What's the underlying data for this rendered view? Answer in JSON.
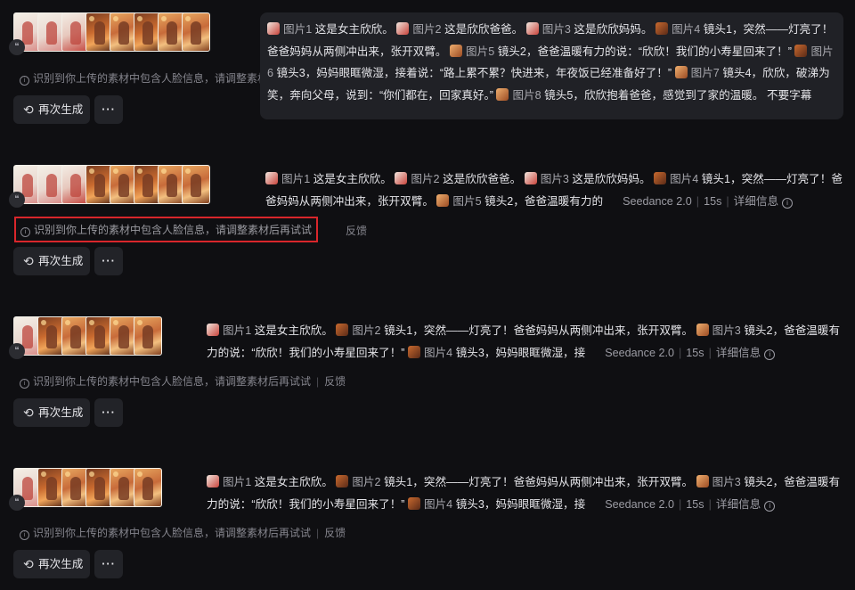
{
  "cards": [
    {
      "prompt_segments": [
        {
          "ref": "图片1",
          "text": "这是女主欣欣。"
        },
        {
          "ref": "图片2",
          "text": "这是欣欣爸爸。"
        },
        {
          "ref": "图片3",
          "text": "这是欣欣妈妈。"
        },
        {
          "ref": "图片4",
          "text": "镜头1，突然——灯亮了！爸爸妈妈从两侧冲出来，张开双臂。"
        },
        {
          "ref": "图片5",
          "text": "镜头2，爸爸温暖有力的说：“欣欣！我们的小寿星回来了！”"
        },
        {
          "ref": "图片6",
          "text": "镜头3，妈妈眼眶微湿，接着说：“路上累不累？快进来，年夜饭已经准备好了！”"
        },
        {
          "ref": "图片7",
          "text": "镜头4，欣欣，破涕为笑，奔向父母，说到：“你们都在，回家真好。”"
        },
        {
          "ref": "图片8",
          "text": "镜头5，欣欣抱着爸爸，感觉到了家的温暖。 不要字幕"
        }
      ],
      "warning": "识别到你上传的素材中包含人脸信息，请调整素材后再试试",
      "regen_label": "再次生成",
      "more_label": "···"
    },
    {
      "prompt_segments": [
        {
          "ref": "图片1",
          "text": "这是女主欣欣。"
        },
        {
          "ref": "图片2",
          "text": "这是欣欣爸爸。"
        },
        {
          "ref": "图片3",
          "text": "这是欣欣妈妈。"
        },
        {
          "ref": "图片4",
          "text": "镜头1，突然——灯亮了！爸爸妈妈从两侧冲出来，张开双臂。"
        },
        {
          "ref": "图片5",
          "text": "镜头2，爸爸温暖有力的"
        }
      ],
      "model": "Seedance 2.0",
      "duration": "15s",
      "details_label": "详细信息",
      "warning": "识别到你上传的素材中包含人脸信息，请调整素材后再试试",
      "feedback_label": "反馈",
      "regen_label": "再次生成",
      "more_label": "···"
    },
    {
      "prompt_segments": [
        {
          "ref": "图片1",
          "text": "这是女主欣欣。"
        },
        {
          "ref": "图片2",
          "text": "镜头1，突然——灯亮了！爸爸妈妈从两侧冲出来，张开双臂。"
        },
        {
          "ref": "图片3",
          "text": "镜头2，爸爸温暖有力的说：“欣欣！我们的小寿星回来了！”"
        },
        {
          "ref": "图片4",
          "text": "镜头3，妈妈眼眶微湿，接"
        }
      ],
      "model": "Seedance 2.0",
      "duration": "15s",
      "details_label": "详细信息",
      "warning": "识别到你上传的素材中包含人脸信息，请调整素材后再试试",
      "feedback_label": "反馈",
      "regen_label": "再次生成",
      "more_label": "···"
    },
    {
      "prompt_segments": [
        {
          "ref": "图片1",
          "text": "这是女主欣欣。"
        },
        {
          "ref": "图片2",
          "text": "镜头1，突然——灯亮了！爸爸妈妈从两侧冲出来，张开双臂。"
        },
        {
          "ref": "图片3",
          "text": "镜头2，爸爸温暖有力的说：“欣欣！我们的小寿星回来了！”"
        },
        {
          "ref": "图片4",
          "text": "镜头3，妈妈眼眶微湿，接"
        }
      ],
      "model": "Seedance 2.0",
      "duration": "15s",
      "details_label": "详细信息",
      "warning": "识别到你上传的素材中包含人脸信息，请调整素材后再试试",
      "feedback_label": "反馈",
      "regen_label": "再次生成",
      "more_label": "···"
    }
  ],
  "icons": {
    "quote": "quote-icon",
    "info": "info-icon",
    "regenerate": "refresh-icon",
    "more": "more-dots-icon"
  },
  "colors": {
    "background": "#0f0f12",
    "highlight_border": "#d9262b"
  }
}
